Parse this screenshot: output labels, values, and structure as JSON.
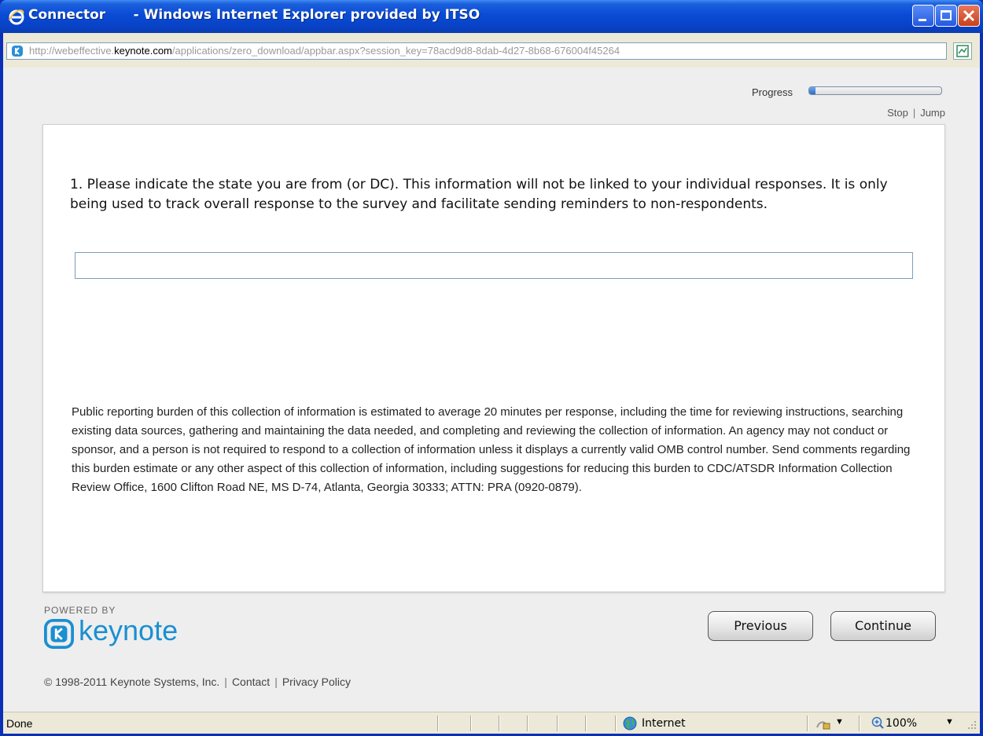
{
  "window": {
    "title": "Connector      - Windows Internet Explorer provided by ITSO"
  },
  "address": {
    "prefix": "http://webeffective.",
    "domain": "keynote.com",
    "path": "/applications/zero_download/appbar.aspx?session_key=78acd9d8-8dab-4d27-8b68-676004f45264"
  },
  "progress": {
    "label": "Progress",
    "value_fraction": 0.05
  },
  "nav": {
    "stop": "Stop",
    "separator": "|",
    "jump": "Jump"
  },
  "question": {
    "text": "1. Please indicate the state you are from (or DC). This information will not be linked to your individual responses. It is only being used to track overall response to the survey and facilitate sending reminders to non-respondents.",
    "answer_value": ""
  },
  "burden_statement": "Public reporting burden of this collection of information is estimated to average 20 minutes per response, including the time for reviewing instructions, searching existing data sources, gathering and maintaining the data needed, and completing and reviewing the collection of information. An agency may not conduct or sponsor, and a person is not required to respond to a collection of information unless it displays a currently valid OMB control number.  Send comments regarding this burden estimate or any other aspect of this collection of information, including suggestions for reducing this burden to CDC/ATSDR Information Collection Review Office, 1600 Clifton Road NE, MS D-74,  Atlanta, Georgia 30333; ATTN:  PRA (0920-0879).",
  "branding": {
    "powered_by": "POWERED BY",
    "logo_text": "keynote",
    "copyright": "© 1998-2011 Keynote Systems, Inc.",
    "contact": "Contact",
    "privacy": "Privacy Policy",
    "separator": "|"
  },
  "buttons": {
    "previous": "Previous",
    "continue": "Continue"
  },
  "statusbar": {
    "status": "Done",
    "zone": "Internet",
    "zoom": "100%"
  },
  "colors": {
    "titlebar": "#0a4bd6",
    "logo": "#1a8fd1",
    "progress_fill": "#2a70c8"
  }
}
